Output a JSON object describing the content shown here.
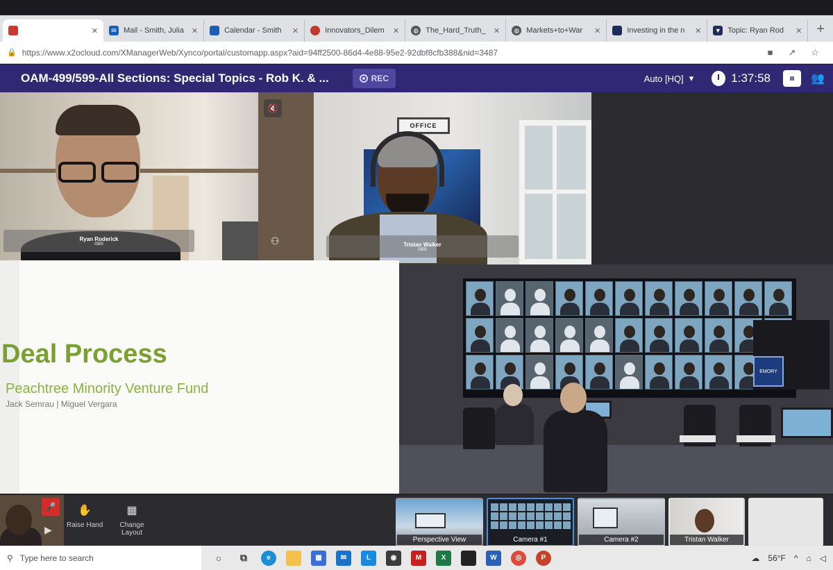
{
  "browser": {
    "tabs": [
      {
        "label": "",
        "color": "#c83a30",
        "active": true
      },
      {
        "label": "Mail - Smith, Julia",
        "color": "#1a5fb4"
      },
      {
        "label": "Calendar - Smith",
        "color": "#1a5fb4"
      },
      {
        "label": "Innovators_Dilem",
        "color": "#c0392b"
      },
      {
        "label": "The_Hard_Truth_",
        "color": "#555555"
      },
      {
        "label": "Markets+to+War",
        "color": "#555555"
      },
      {
        "label": "Investing in the n",
        "color": "#1f2b5a"
      },
      {
        "label": "Topic: Ryan Rod",
        "color": "#1f2b5a"
      }
    ],
    "url": "https://www.x2ocloud.com/XManagerWeb/Xynco/portal/customapp.aspx?aid=94ff2500-86d4-4e88-95e2-92dbf8cfb388&nid=3487"
  },
  "app": {
    "title": "OAM-499/599-All Sections: Special Topics - Rob K. & ...",
    "rec_label": "REC",
    "quality": "Auto [HQ]",
    "timer": "1:37:58",
    "accent": "#302873"
  },
  "participants": {
    "ryan": {
      "name": "Ryan Roderick",
      "org": "GBS"
    },
    "tristan": {
      "name": "Tristan Walker",
      "org": "GBS"
    },
    "office_sign": "OFFICE"
  },
  "slide": {
    "title": "Deal Process",
    "subtitle": "Peachtree Minority Venture Fund",
    "authors": "Jack Semrau | Miguel Vergara",
    "title_color": "#7aa033"
  },
  "classroom": {
    "emory_label": "EMORY"
  },
  "controls": {
    "raise_hand": "Raise Hand",
    "change_layout": "Change Layout"
  },
  "views": [
    {
      "label": "Perspective View"
    },
    {
      "label": "Camera #1"
    },
    {
      "label": "Camera #2"
    },
    {
      "label": "Tristan Walker"
    }
  ],
  "taskbar": {
    "search_placeholder": "Type here to search",
    "temperature": "56°F"
  }
}
